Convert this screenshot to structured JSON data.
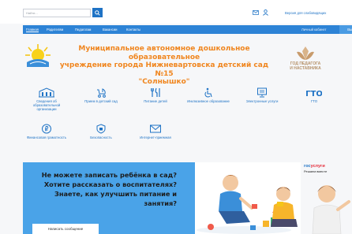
{
  "header": {
    "search_placeholder": "Найти...",
    "accessibility_link": "Версия для слабовидящих"
  },
  "nav": {
    "items": [
      "Главная",
      "Родителям",
      "Педагогам",
      "Вакансии",
      "Контакты"
    ],
    "cabinet": "Личный кабинет",
    "exit": "Выйти"
  },
  "org": {
    "title_line1": "Муниципальное автономное дошкольное образовательное",
    "title_line2": "учреждение города Нижневартовска детский сад №15",
    "title_line3": "\"Солнышко\""
  },
  "year_badge": {
    "line1": "ГОД ПЕДАГОГА",
    "line2": "И НАСТАВНИКА"
  },
  "services": [
    {
      "icon": "building-icon",
      "label": "Сведения об образовательной организации"
    },
    {
      "icon": "stroller-icon",
      "label": "Прием в детский сад"
    },
    {
      "icon": "cutlery-icon",
      "label": "Питание детей"
    },
    {
      "icon": "inclusive-icon",
      "label": "Инклюзивное образование"
    },
    {
      "icon": "monitor-icon",
      "label": "Электронные услуги"
    },
    {
      "icon": "gto-icon",
      "label": "ГТО",
      "icon_text": "ГТО"
    },
    {
      "icon": "coin-icon",
      "label": "Финансовая грамотность"
    },
    {
      "icon": "shield-icon",
      "label": "Безопасность"
    },
    {
      "icon": "envelope-icon",
      "label": "Интернет-приемная"
    }
  ],
  "banner": {
    "line1": "Не можете записать ребёнка в сад?",
    "line2": "Хотите рассказать о воспитателях?",
    "line3": "Знаете, как улучшить питание и",
    "line4": "занятия?",
    "button": "Написать сообщение"
  },
  "gosuslugi": {
    "part1": "гос",
    "part2": "услуги",
    "tagline": "Решаем вместе"
  },
  "colors": {
    "accent": "#1f73c5",
    "nav": "#2d83d6",
    "title": "#f0861f",
    "banner": "#4aa3e8"
  }
}
